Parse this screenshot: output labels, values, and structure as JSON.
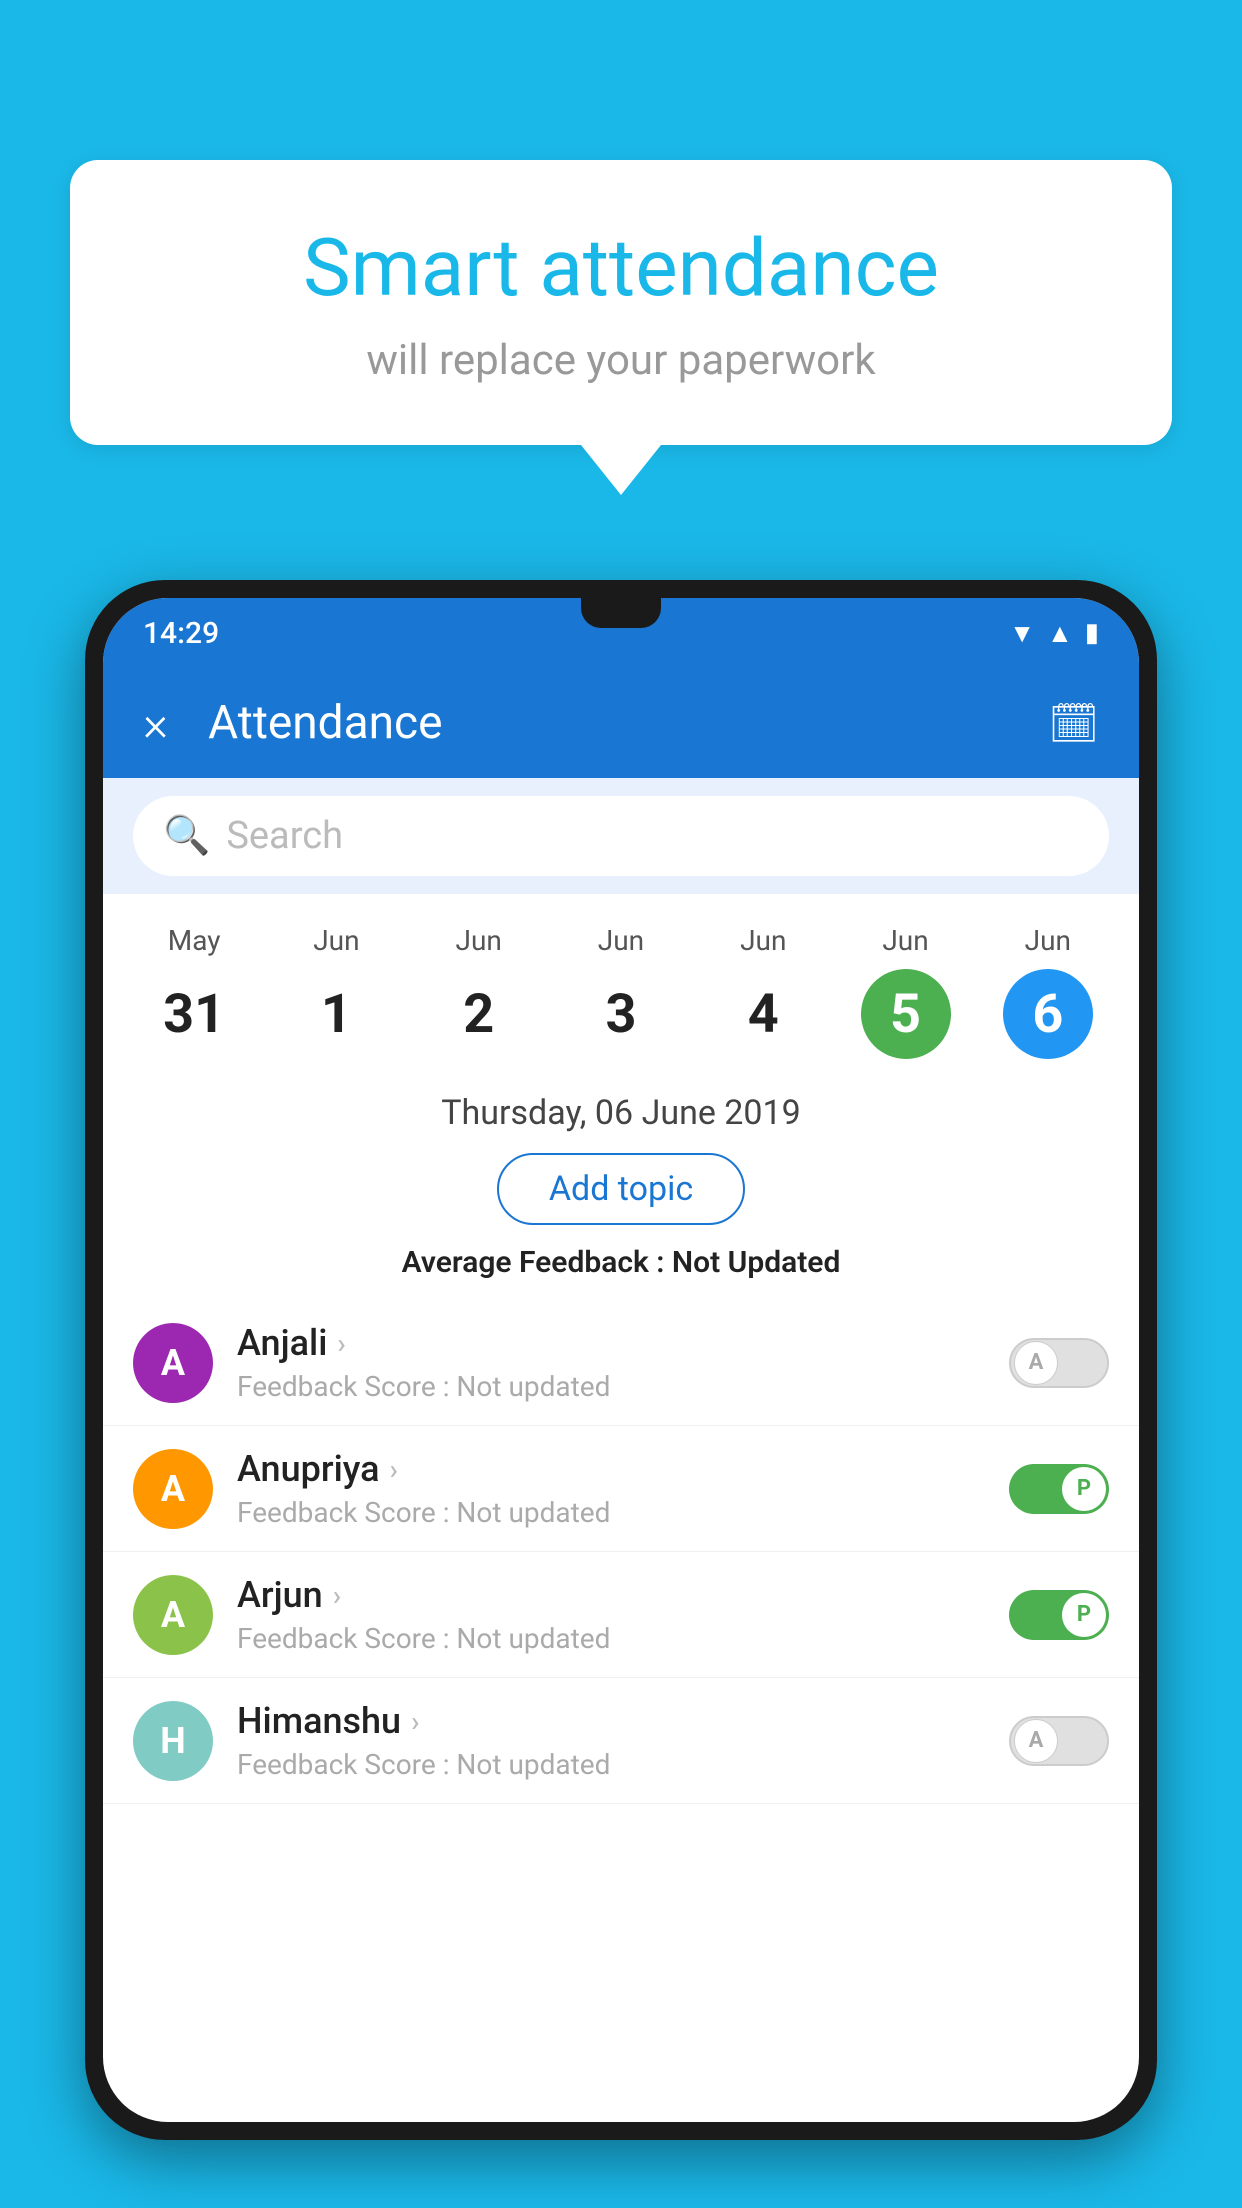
{
  "background_color": "#1ab8e8",
  "bubble": {
    "title": "Smart attendance",
    "subtitle": "will replace your paperwork"
  },
  "status_bar": {
    "time": "14:29",
    "icons": [
      "wifi",
      "signal",
      "battery"
    ]
  },
  "app_bar": {
    "title": "Attendance",
    "close_label": "×",
    "calendar_label": "📅"
  },
  "search": {
    "placeholder": "Search"
  },
  "calendar": {
    "days": [
      {
        "month": "May",
        "date": "31",
        "style": "normal"
      },
      {
        "month": "Jun",
        "date": "1",
        "style": "normal"
      },
      {
        "month": "Jun",
        "date": "2",
        "style": "normal"
      },
      {
        "month": "Jun",
        "date": "3",
        "style": "normal"
      },
      {
        "month": "Jun",
        "date": "4",
        "style": "normal"
      },
      {
        "month": "Jun",
        "date": "5",
        "style": "green"
      },
      {
        "month": "Jun",
        "date": "6",
        "style": "blue"
      }
    ],
    "selected_date": "Thursday, 06 June 2019"
  },
  "add_topic_label": "Add topic",
  "avg_feedback": {
    "label": "Average Feedback : ",
    "value": "Not Updated"
  },
  "students": [
    {
      "name": "Anjali",
      "avatar_letter": "A",
      "avatar_color": "purple",
      "feedback": "Feedback Score : Not updated",
      "toggle": "off",
      "toggle_label": "A"
    },
    {
      "name": "Anupriya",
      "avatar_letter": "A",
      "avatar_color": "orange",
      "feedback": "Feedback Score : Not updated",
      "toggle": "on",
      "toggle_label": "P"
    },
    {
      "name": "Arjun",
      "avatar_letter": "A",
      "avatar_color": "light-green",
      "feedback": "Feedback Score : Not updated",
      "toggle": "on",
      "toggle_label": "P"
    },
    {
      "name": "Himanshu",
      "avatar_letter": "H",
      "avatar_color": "teal",
      "feedback": "Feedback Score : Not updated",
      "toggle": "off",
      "toggle_label": "A"
    }
  ]
}
